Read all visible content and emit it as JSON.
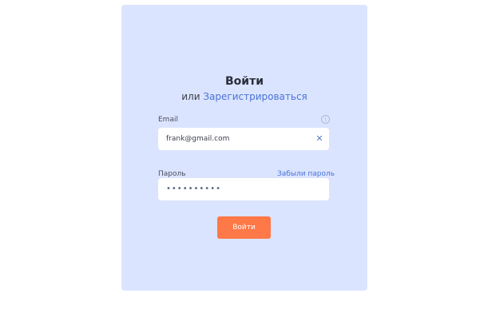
{
  "form": {
    "title": "Войти",
    "subtitle_prefix": "или",
    "register_link": "Зарегистрироваться",
    "email_label": "Email",
    "email_value": "frank@gmail.com",
    "info_icon": "info-icon",
    "clear_icon_glyph": "✕",
    "password_label": "Пароль",
    "forgot_link": "Забыли пароль",
    "password_masked": "••••••••••",
    "submit_label": "Войти"
  },
  "colors": {
    "card_background": "#dbe4ff",
    "accent_link": "#4a74d8",
    "submit_button": "#ff7847"
  }
}
